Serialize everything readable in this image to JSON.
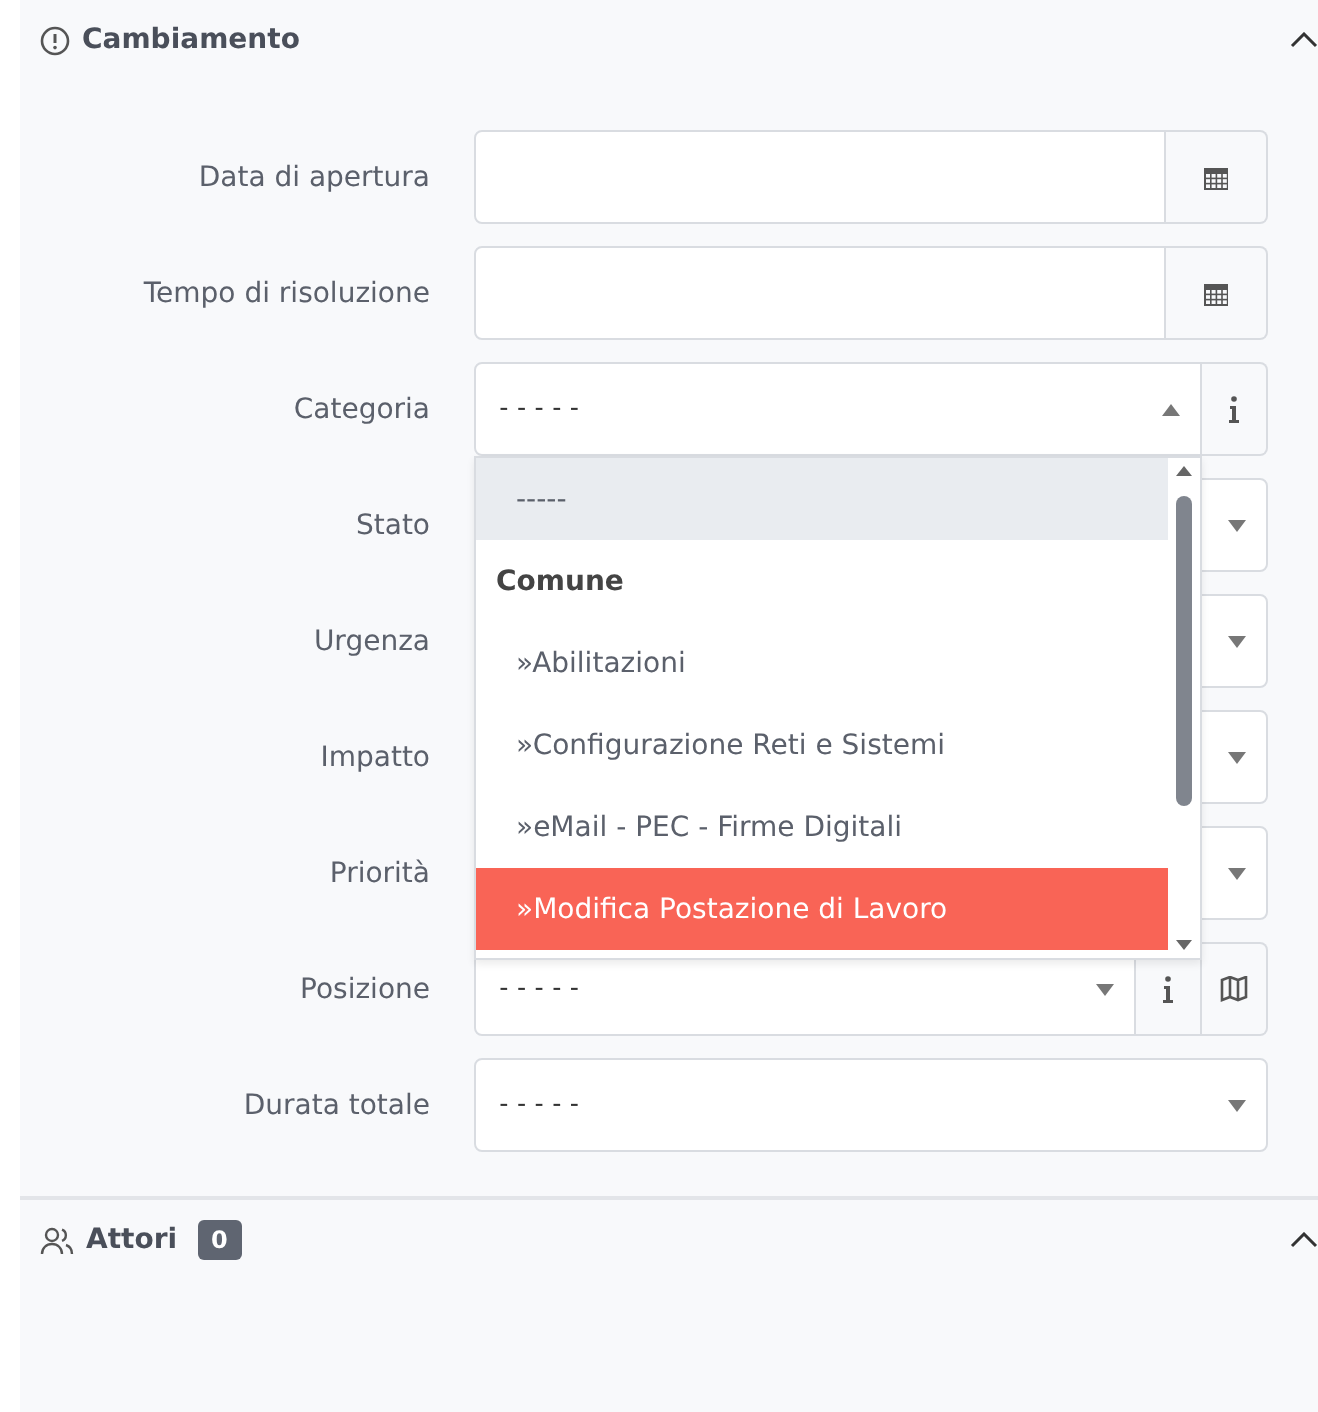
{
  "sections": [
    {
      "title": "Cambiamento",
      "expanded": true,
      "fields": [
        {
          "label": "Data di apertura",
          "kind": "date"
        },
        {
          "label": "Tempo di risoluzione",
          "kind": "date"
        },
        {
          "label": "Categoria",
          "kind": "select",
          "value": "-----",
          "info": true,
          "open": true,
          "options": [
            {
              "text": "-----",
              "kind": "option",
              "hovered": false,
              "selected": true
            },
            {
              "text": "Comune",
              "kind": "group"
            },
            {
              "text": "»Abilitazioni",
              "kind": "option",
              "hovered": false,
              "selected": false
            },
            {
              "text": "»Configurazione Reti e Sistemi",
              "kind": "option",
              "hovered": false,
              "selected": false
            },
            {
              "text": "»eMail - PEC - Firme Digitali",
              "kind": "option",
              "hovered": false,
              "selected": false
            },
            {
              "text": "»Modifica Postazione di Lavoro",
              "kind": "option",
              "hovered": true,
              "selected": false
            }
          ]
        },
        {
          "label": "Stato",
          "kind": "select"
        },
        {
          "label": "Urgenza",
          "kind": "select"
        },
        {
          "label": "Impatto",
          "kind": "select"
        },
        {
          "label": "Priorità",
          "kind": "select"
        },
        {
          "label": "Posizione",
          "kind": "select",
          "value": "-----",
          "info": true,
          "map": true
        },
        {
          "label": "Durata totale",
          "kind": "select",
          "value": "-----"
        }
      ]
    },
    {
      "title": "Attori",
      "badge": "0",
      "expanded": true
    }
  ]
}
